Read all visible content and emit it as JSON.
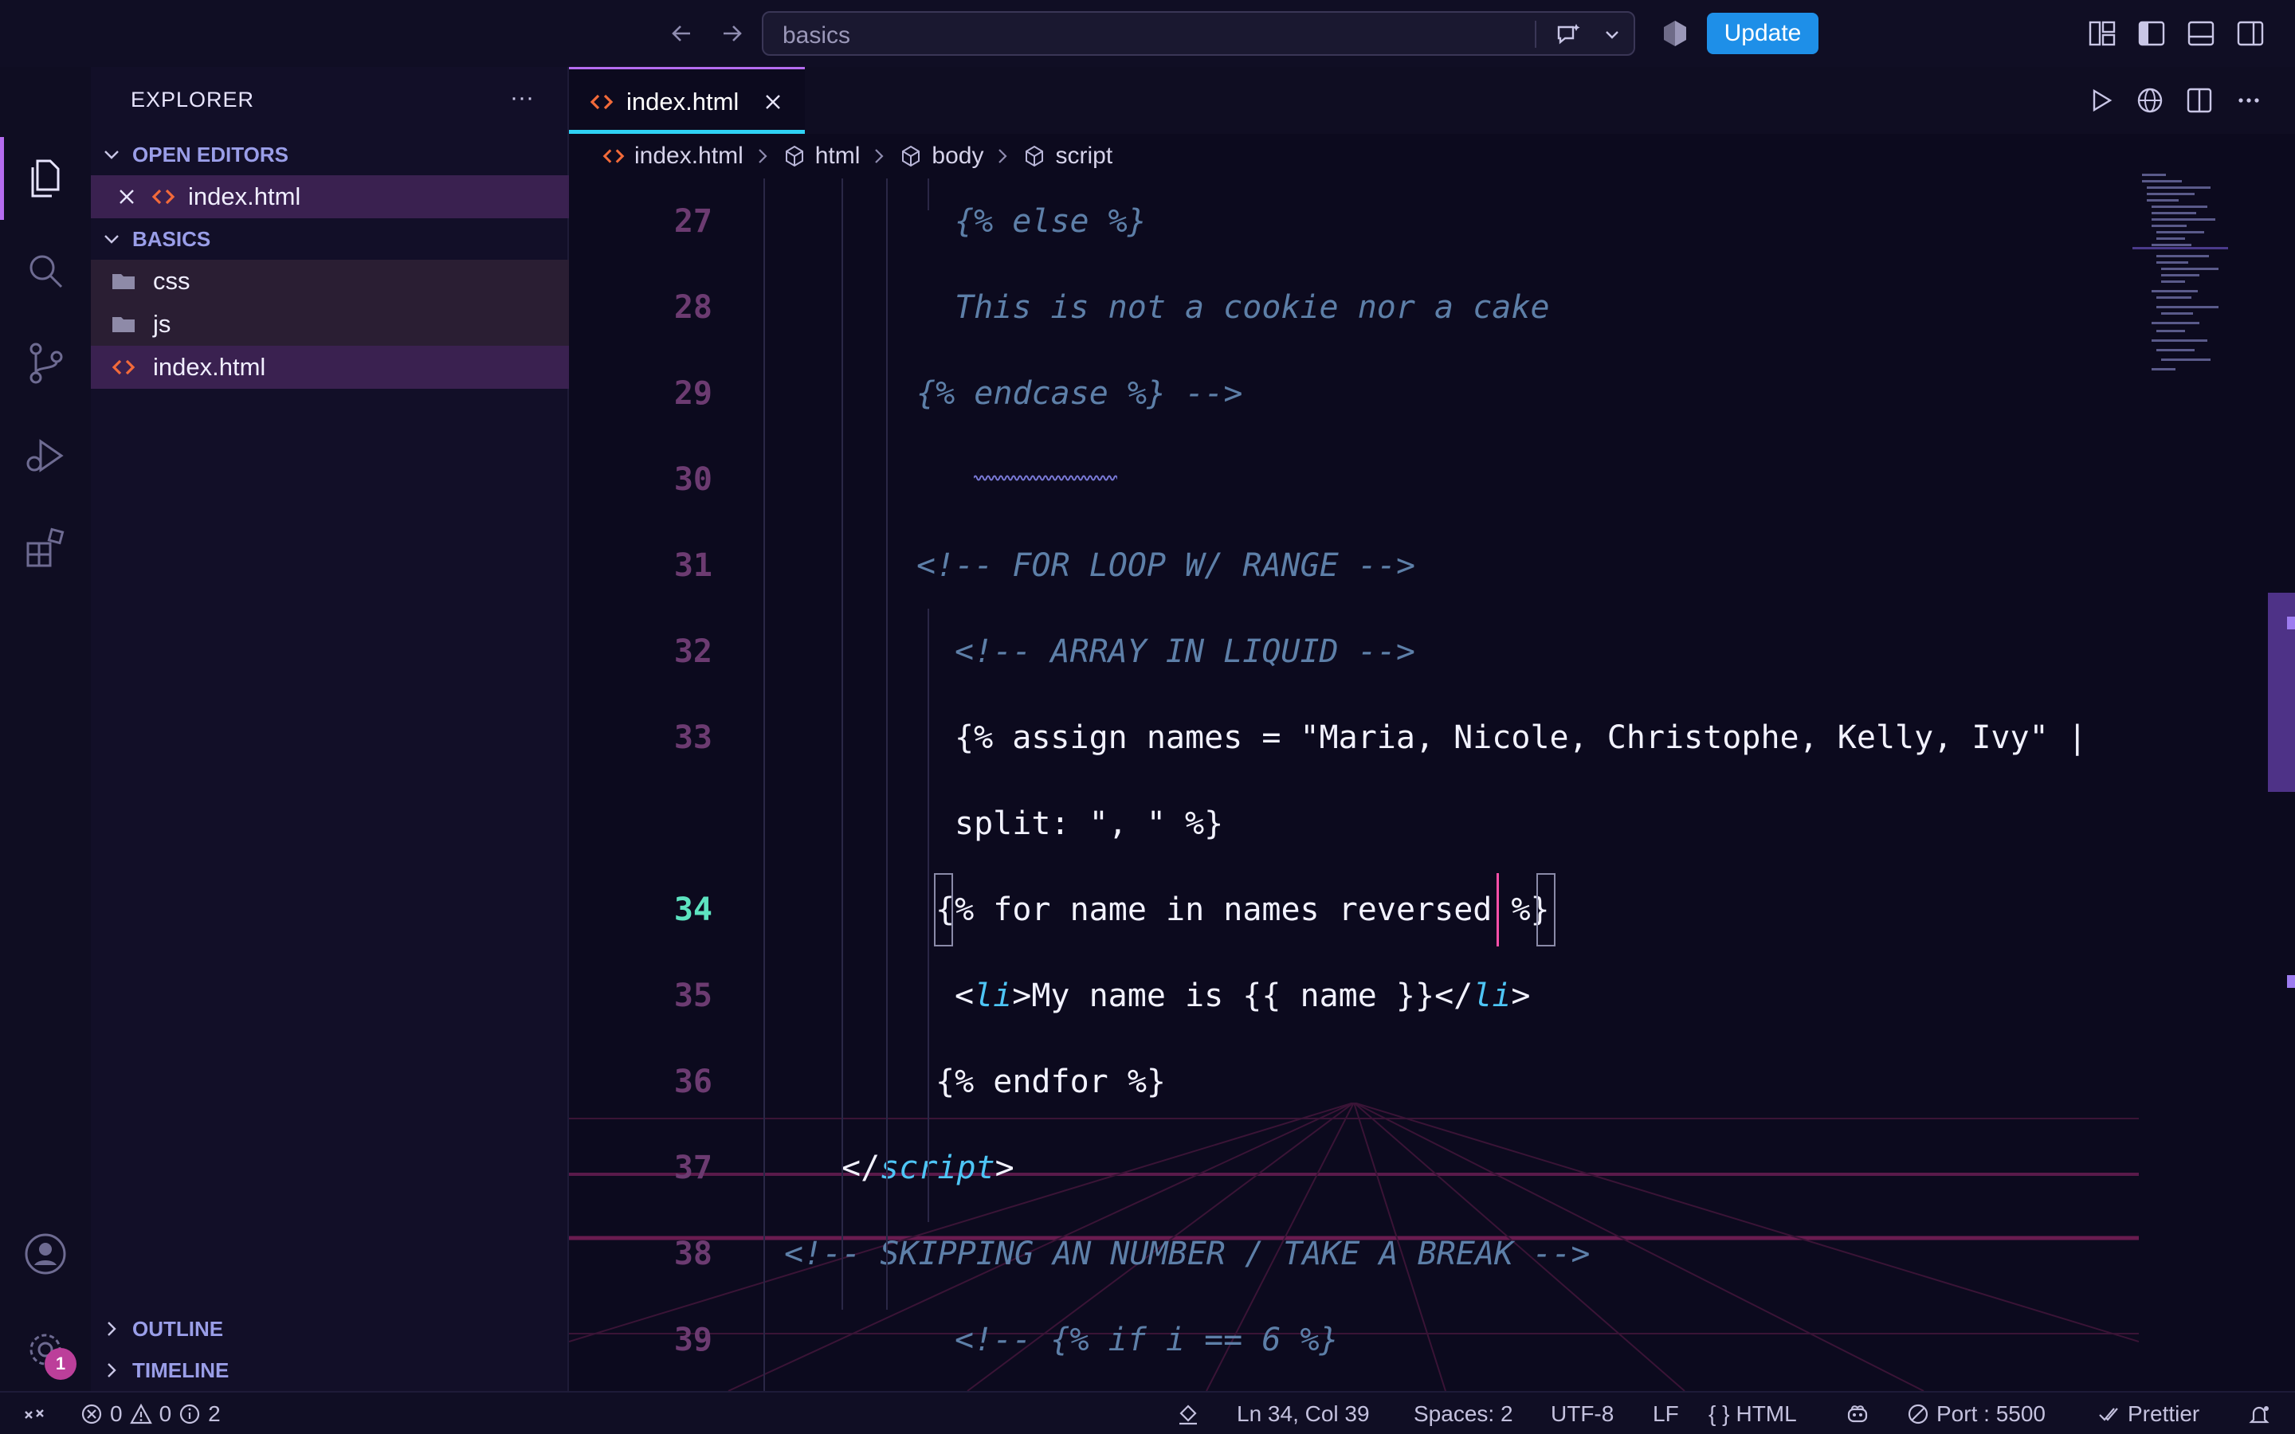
{
  "titlebar": {
    "search_text": "basics",
    "update_label": "Update"
  },
  "sidebar": {
    "title": "EXPLORER",
    "more": "···",
    "open_editors": {
      "label": "OPEN EDITORS",
      "files": [
        "index.html"
      ]
    },
    "workspace": {
      "label": "BASICS",
      "items": [
        {
          "name": "css",
          "type": "folder"
        },
        {
          "name": "js",
          "type": "folder"
        },
        {
          "name": "index.html",
          "type": "html"
        }
      ]
    },
    "outline_label": "OUTLINE",
    "timeline_label": "TIMELINE"
  },
  "activity": {
    "settings_badge": "1"
  },
  "editor": {
    "tab_label": "index.html",
    "breadcrumb": [
      "index.html",
      "html",
      "body",
      "script"
    ],
    "lines": [
      {
        "n": "27",
        "parts": [
          {
            "t": "{% else %}",
            "c": "cmt"
          }
        ]
      },
      {
        "n": "28",
        "parts": [
          {
            "t": "This is not a cookie nor a cake",
            "c": "cmt"
          }
        ]
      },
      {
        "n": "29",
        "parts": [
          {
            "t": "{% endcase %} -->",
            "c": "cmt"
          }
        ]
      },
      {
        "n": "30",
        "parts": []
      },
      {
        "n": "31",
        "parts": [
          {
            "t": "<!-- FOR LOOP W/ RANGE -->",
            "c": "cmt"
          }
        ]
      },
      {
        "n": "32",
        "parts": [
          {
            "t": "<!-- ARRAY IN LIQUID -->",
            "c": "cmt"
          }
        ]
      },
      {
        "n": "33",
        "parts": [
          {
            "t": "{% assign names = \"Maria, Nicole, Christophe, Kelly, Ivy\" |",
            "c": "plain"
          }
        ]
      },
      {
        "n": "",
        "parts": [
          {
            "t": "split: \", \" %}",
            "c": "plain"
          }
        ]
      },
      {
        "n": "34",
        "parts": [
          {
            "t": "{% for name in names reversed %}",
            "c": "plain"
          }
        ]
      },
      {
        "n": "35",
        "parts": [
          {
            "t": "<",
            "c": "plain"
          },
          {
            "t": "li",
            "c": "tag"
          },
          {
            "t": ">My name is {{ name }}</",
            "c": "plain"
          },
          {
            "t": "li",
            "c": "tag"
          },
          {
            "t": ">",
            "c": "plain"
          }
        ]
      },
      {
        "n": "36",
        "parts": [
          {
            "t": "{% endfor %}",
            "c": "plain"
          }
        ]
      },
      {
        "n": "37",
        "parts": [
          {
            "t": "</",
            "c": "plain"
          },
          {
            "t": "script",
            "c": "tag"
          },
          {
            "t": ">",
            "c": "plain"
          }
        ]
      },
      {
        "n": "38",
        "parts": [
          {
            "t": "<!-- SKIPPING AN NUMBER / TAKE A BREAK -->",
            "c": "cmt"
          }
        ]
      },
      {
        "n": "39",
        "parts": [
          {
            "t": "<!-- {% if i == 6 %}",
            "c": "cmt"
          }
        ]
      }
    ],
    "active_line": "34"
  },
  "status": {
    "errors": "0",
    "warnings": "0",
    "info": "2",
    "cursor": "Ln 34, Col 39",
    "spaces": "Spaces: 2",
    "encoding": "UTF-8",
    "eol": "LF",
    "language": "HTML",
    "port": "Port : 5500",
    "formatter": "Prettier"
  },
  "colors": {
    "accent": "#b56cf0",
    "tab_underline": "#2fd2f5",
    "update_button": "#1e8fe8",
    "line_number": "#6c3b71",
    "active_line_number": "#5de3c0",
    "comment": "#5d7fa8",
    "tag": "#4ec5f5"
  }
}
